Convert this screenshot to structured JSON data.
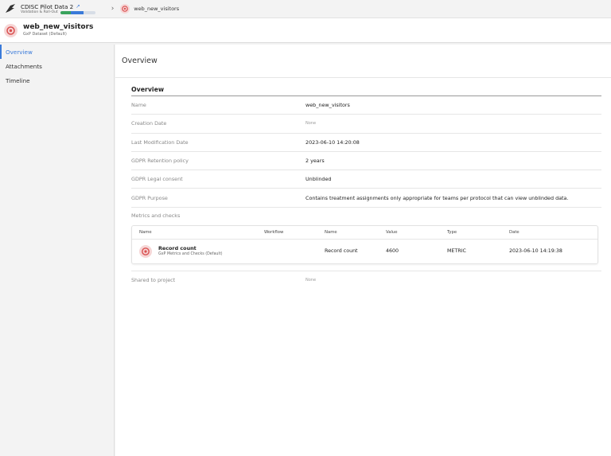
{
  "topbar": {
    "project_title": "CDISC Pilot Data 2",
    "project_subtitle": "Validation & Roll-Out",
    "breadcrumb": "web_new_visitors"
  },
  "header": {
    "title": "web_new_visitors",
    "subtitle": "GxP Dataset (Default)"
  },
  "sidebar": {
    "items": [
      {
        "label": "Overview",
        "active": true
      },
      {
        "label": "Attachments",
        "active": false
      },
      {
        "label": "Timeline",
        "active": false
      }
    ]
  },
  "main": {
    "title": "Overview",
    "section_title": "Overview",
    "fields": [
      {
        "label": "Name",
        "value": "web_new_visitors"
      },
      {
        "label": "Creation Date",
        "value": "None"
      },
      {
        "label": "Last Modification Date",
        "value": "2023-06-10 14:20:08"
      },
      {
        "label": "GDPR Retention policy",
        "value": "2 years"
      },
      {
        "label": "GDPR Legal consent",
        "value": "Unblinded"
      },
      {
        "label": "GDPR Purpose",
        "value": "Contains treatment assignments only appropriate for teams per protocol that can view unblinded data."
      }
    ],
    "metrics_label": "Metrics and checks",
    "metrics_columns": [
      "Name",
      "Workflow",
      "Name",
      "Value",
      "Type",
      "Date"
    ],
    "metrics_rows": [
      {
        "name": "Record count",
        "subtitle": "GxP Metrics and Checks (Default)",
        "metric_name": "Record count",
        "value": "4600",
        "type": "METRIC",
        "date": "2023-06-10 14:19:38"
      }
    ],
    "shared_label": "Shared to project",
    "shared_value": "None"
  },
  "colors": {
    "accent": "#3a7ad9",
    "dataset_icon": "#e36b6b",
    "progress_green": "#3aa35d"
  }
}
